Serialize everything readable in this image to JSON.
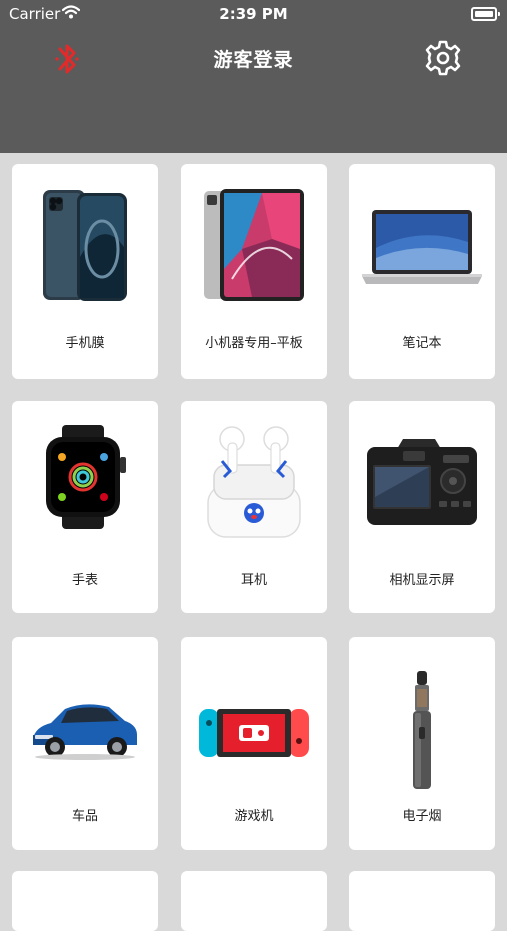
{
  "status_bar": {
    "carrier": "Carrier",
    "time": "2:39 PM"
  },
  "nav": {
    "title": "游客登录",
    "bluetooth_icon": "bluetooth-icon",
    "settings_icon": "gear-icon"
  },
  "categories": [
    {
      "label": "手机膜",
      "icon": "phone-image"
    },
    {
      "label": "小机器专用–平板",
      "icon": "tablet-image"
    },
    {
      "label": "笔记本",
      "icon": "laptop-image"
    },
    {
      "label": "手表",
      "icon": "watch-image"
    },
    {
      "label": "耳机",
      "icon": "earbuds-image"
    },
    {
      "label": "相机显示屏",
      "icon": "camera-image"
    },
    {
      "label": "车品",
      "icon": "car-image"
    },
    {
      "label": "游戏机",
      "icon": "game-console-image"
    },
    {
      "label": "电子烟",
      "icon": "e-cigarette-image"
    }
  ],
  "colors": {
    "header_bg": "#5b5b5b",
    "bluetooth_red": "#e12b2b",
    "grid_bg": "#d9d9d9"
  }
}
